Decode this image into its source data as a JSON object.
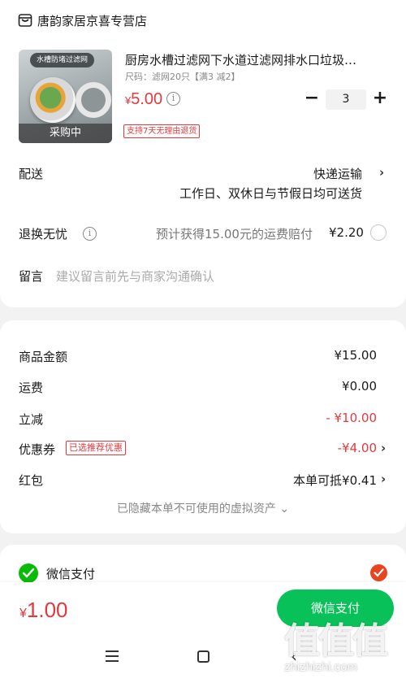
{
  "store": {
    "name": "唐韵家居京喜专营店",
    "icon": "store-icon"
  },
  "product": {
    "image_tag": "水槽防堵过滤网",
    "image_overlay": "采购中",
    "title": "厨房水槽过滤网下水道过滤网排水口垃圾…",
    "spec": "尺码：滤网20只【满3 减2】",
    "price_currency": "¥",
    "price_value": "5.00",
    "policy_tag": "支持7天无理由退货",
    "quantity": "3",
    "minus_label": "−",
    "plus_label": "+"
  },
  "delivery": {
    "label": "配送",
    "method": "快递运输",
    "note": "工作日、双休日与节假日均可送货"
  },
  "returns": {
    "label": "退换无忧",
    "desc": "预计获得15.00元的运费赔付",
    "price": "¥2.20"
  },
  "message": {
    "label": "留言",
    "placeholder": "建议留言前先与商家沟通确认"
  },
  "summary": {
    "goods_label": "商品金额",
    "goods_value": "¥15.00",
    "shipping_label": "运费",
    "shipping_value": "¥0.00",
    "discount_label": "立减",
    "discount_value": "- ¥10.00",
    "coupon_label": "优惠券",
    "coupon_tag": "已选推荐优惠",
    "coupon_value": "-¥4.00",
    "redpacket_label": "红包",
    "redpacket_value": "本单可抵¥0.41",
    "hidden_assets": "已隐藏本单不可使用的虚拟资产 ⌄"
  },
  "payment": {
    "method_label": "微信支付",
    "total_currency": "¥",
    "total_value": "1.00",
    "pay_button": "微信支付"
  },
  "watermark": {
    "text": "值值值",
    "url": "zhizhizhi.com"
  },
  "colors": {
    "accent_red": "#e4393c",
    "wechat_green": "#09c159",
    "check_orange": "#e8441f"
  }
}
